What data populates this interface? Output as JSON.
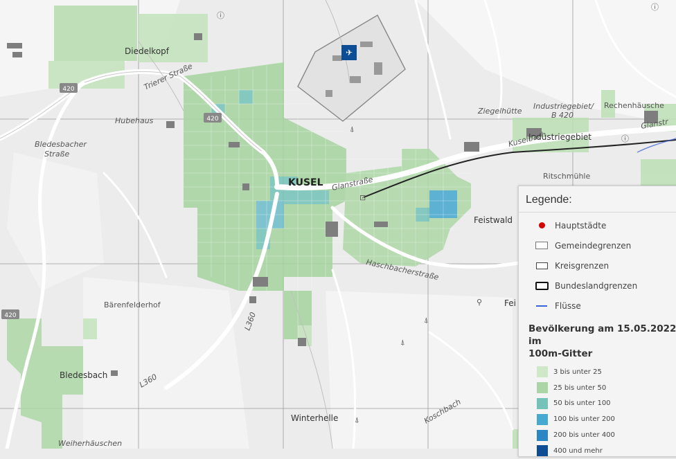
{
  "map": {
    "place_labels": {
      "diedelkopf": "Diedelkopf",
      "hubehaus": "Hubehaus",
      "bledesbacher_strasse_1": "Bledesbacher",
      "bledesbacher_strasse_2": "Straße",
      "trierer_strasse": "Trierer Straße",
      "kusel": "KUSEL",
      "glanstrasse": "Glanstraße",
      "ziegelhuette": "Ziegelhütte",
      "industriegebiet_b420_1": "Industriegebiet/",
      "industriegebiet_b420_2": "B 420",
      "industriegebiet": "Industriegebiet",
      "rechenhaeuschen": "Rechenhäusche",
      "glanstr_east": "Glanstr",
      "ritschmuehle": "Ritschmühle",
      "feistwald": "Feistwald",
      "haschbacherstrasse": "Haschbacherstraße",
      "baerenfelderhof": "Bärenfelderhof",
      "bledesbach": "Bledesbach",
      "weiherhaeuschen": "Weiherhäuschen",
      "winterhelle": "Winterhelle",
      "l360_a": "L360",
      "l360_b": "L360",
      "fei": "Fei",
      "koschbach": "Koschbach",
      "krebsbach": "Kuselbach"
    },
    "road_shields": {
      "b420_north": "420",
      "b420_center": "420",
      "b420_south": "420"
    }
  },
  "legend": {
    "title": "Legende:",
    "items": [
      {
        "label": "Hauptstädte",
        "symbol": "red-dot"
      },
      {
        "label": "Gemeindegrenzen",
        "symbol": "thin-box"
      },
      {
        "label": "Kreisgrenzen",
        "symbol": "medium-box"
      },
      {
        "label": "Bundeslandgrenzen",
        "symbol": "thick-box"
      },
      {
        "label": "Flüsse",
        "symbol": "blue-line"
      }
    ],
    "population_title_1": "Bevölkerung am 15.05.2022 im",
    "population_title_2": "100m-Gitter",
    "classes": [
      {
        "label": "3 bis unter 25",
        "color": "#cfe8c8"
      },
      {
        "label": "25 bis unter 50",
        "color": "#a9d6a4"
      },
      {
        "label": "50 bis unter 100",
        "color": "#74c2b8"
      },
      {
        "label": "100 bis unter 200",
        "color": "#45a9d0"
      },
      {
        "label": "200 bis unter 400",
        "color": "#2a86c4"
      },
      {
        "label": "400 und mehr",
        "color": "#0d4d96"
      }
    ]
  }
}
